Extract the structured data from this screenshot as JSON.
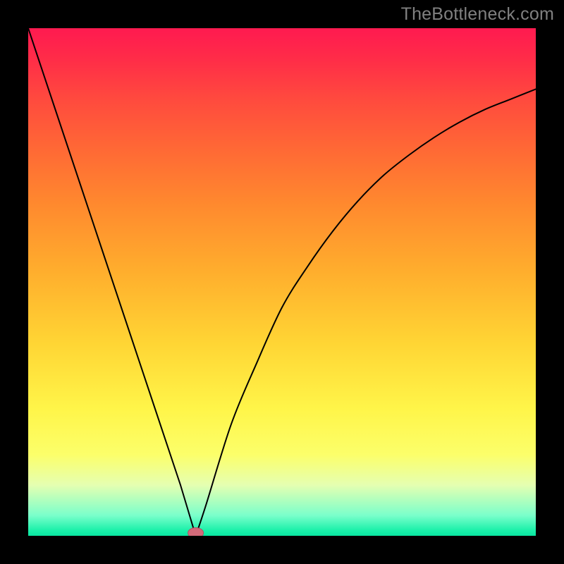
{
  "watermark": {
    "text": "TheBottleneck.com"
  },
  "colors": {
    "curve": "#000000",
    "marker_fill": "#d36a7a",
    "marker_stroke": "#b25163",
    "background_black": "#000000"
  },
  "chart_data": {
    "type": "line",
    "title": "",
    "xlabel": "",
    "ylabel": "",
    "xlim": [
      0,
      100
    ],
    "ylim": [
      0,
      100
    ],
    "grid": false,
    "legend": false,
    "series": [
      {
        "name": "bottleneck-curve",
        "type": "line",
        "x": [
          0,
          5,
          10,
          15,
          20,
          25,
          30,
          33,
          35,
          40,
          45,
          50,
          55,
          60,
          65,
          70,
          75,
          80,
          85,
          90,
          95,
          100
        ],
        "values": [
          100,
          85,
          70,
          55,
          40,
          25,
          10,
          0,
          6,
          22,
          34,
          45,
          53,
          60,
          66,
          71,
          75,
          78.5,
          81.5,
          84,
          86,
          88
        ]
      }
    ],
    "marker": {
      "name": "optimum-point",
      "x": 33,
      "y": 0
    },
    "gradient_stops": [
      {
        "pos": 0,
        "color": "#ff1a50"
      },
      {
        "pos": 6,
        "color": "#ff2c48"
      },
      {
        "pos": 14,
        "color": "#ff4a3e"
      },
      {
        "pos": 24,
        "color": "#ff6935"
      },
      {
        "pos": 35,
        "color": "#ff8a2e"
      },
      {
        "pos": 48,
        "color": "#ffae2d"
      },
      {
        "pos": 62,
        "color": "#ffd534"
      },
      {
        "pos": 75,
        "color": "#fff549"
      },
      {
        "pos": 84,
        "color": "#fcff6a"
      },
      {
        "pos": 90,
        "color": "#e5ffb1"
      },
      {
        "pos": 96,
        "color": "#7affcb"
      },
      {
        "pos": 99,
        "color": "#19f0a9"
      },
      {
        "pos": 100,
        "color": "#0ae6a2"
      }
    ]
  }
}
